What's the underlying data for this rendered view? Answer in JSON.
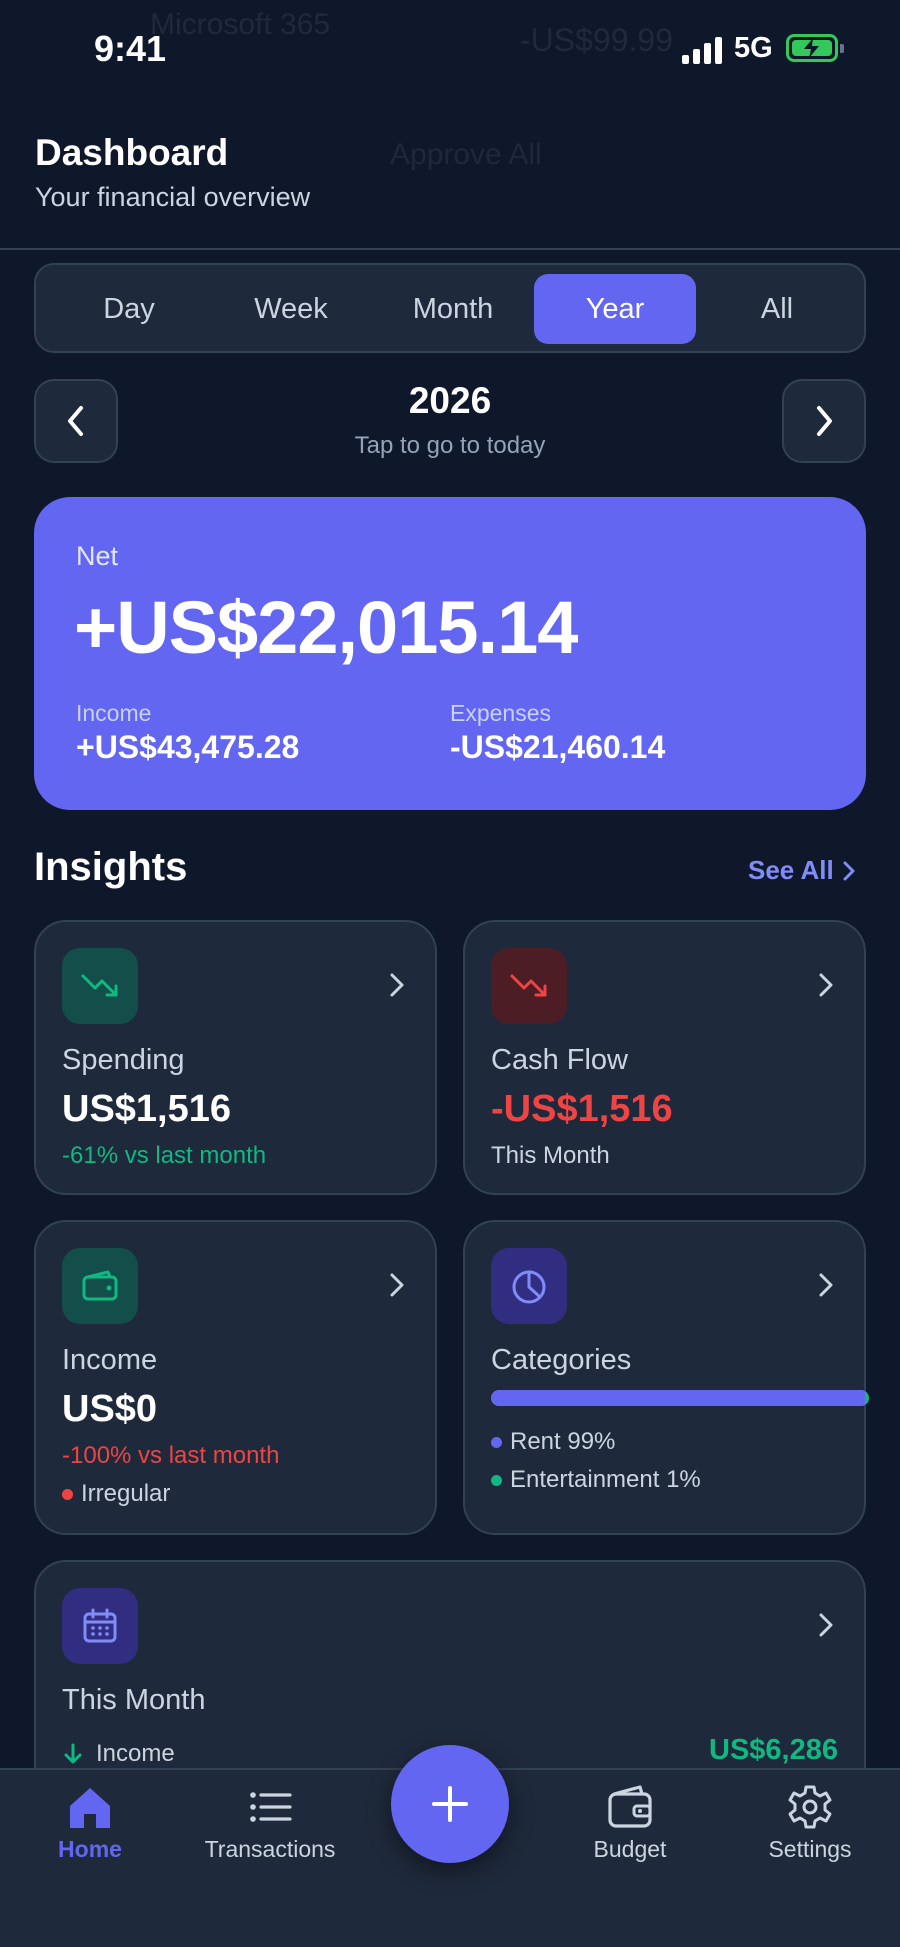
{
  "status_bar": {
    "time": "9:41",
    "network": "5G",
    "ghost_left": "Microsoft 365",
    "ghost_right": "-US$99.99",
    "ghost_mid": "Approve All",
    "battery_color": "#34c759"
  },
  "header": {
    "title": "Dashboard",
    "subtitle": "Your financial overview"
  },
  "period_tabs": {
    "items": [
      "Day",
      "Week",
      "Month",
      "Year",
      "All"
    ],
    "selected": "Year"
  },
  "period_nav": {
    "label": "2026",
    "hint": "Tap to go to today",
    "prev_icon": "chevron-left-icon",
    "next_icon": "chevron-right-icon"
  },
  "net_card": {
    "label": "Net",
    "value": "+US$22,015.14",
    "income_label": "Income",
    "income_value": "+US$43,475.28",
    "expenses_label": "Expenses",
    "expenses_value": "-US$21,460.14",
    "color": "#6366f1"
  },
  "insights": {
    "title": "Insights",
    "see_all": "See All",
    "spending": {
      "icon": "trending-down-icon",
      "title": "Spending",
      "value": "US$1,516",
      "note": "-61% vs last month"
    },
    "cash_flow": {
      "icon": "trending-down-icon",
      "title": "Cash Flow",
      "value": "-US$1,516",
      "note": "This Month"
    },
    "income": {
      "icon": "wallet-icon",
      "title": "Income",
      "value": "US$0",
      "note": "-100% vs last month",
      "tag": "Irregular"
    },
    "categories": {
      "icon": "pie-chart-icon",
      "title": "Categories",
      "items": [
        {
          "label": "Rent 99%",
          "share": 0.99,
          "color": "#6366f1"
        },
        {
          "label": "Entertainment 1%",
          "share": 0.01,
          "color": "#10b981"
        }
      ]
    },
    "this_month": {
      "icon": "calendar-icon",
      "title": "This Month",
      "income_label": "Income",
      "income_value": "US$6,286"
    }
  },
  "tabbar": {
    "items": [
      {
        "label": "Home",
        "icon": "home-icon",
        "active": true
      },
      {
        "label": "Transactions",
        "icon": "list-icon",
        "active": false
      },
      {
        "label": "Budget",
        "icon": "wallet-icon",
        "active": false
      },
      {
        "label": "Settings",
        "icon": "gear-icon",
        "active": false
      }
    ],
    "add_icon": "plus-icon"
  },
  "colors": {
    "background": "#0f172a",
    "card": "#1e293b",
    "accent": "#6366f1",
    "positive": "#10b981",
    "negative": "#ef4444"
  }
}
